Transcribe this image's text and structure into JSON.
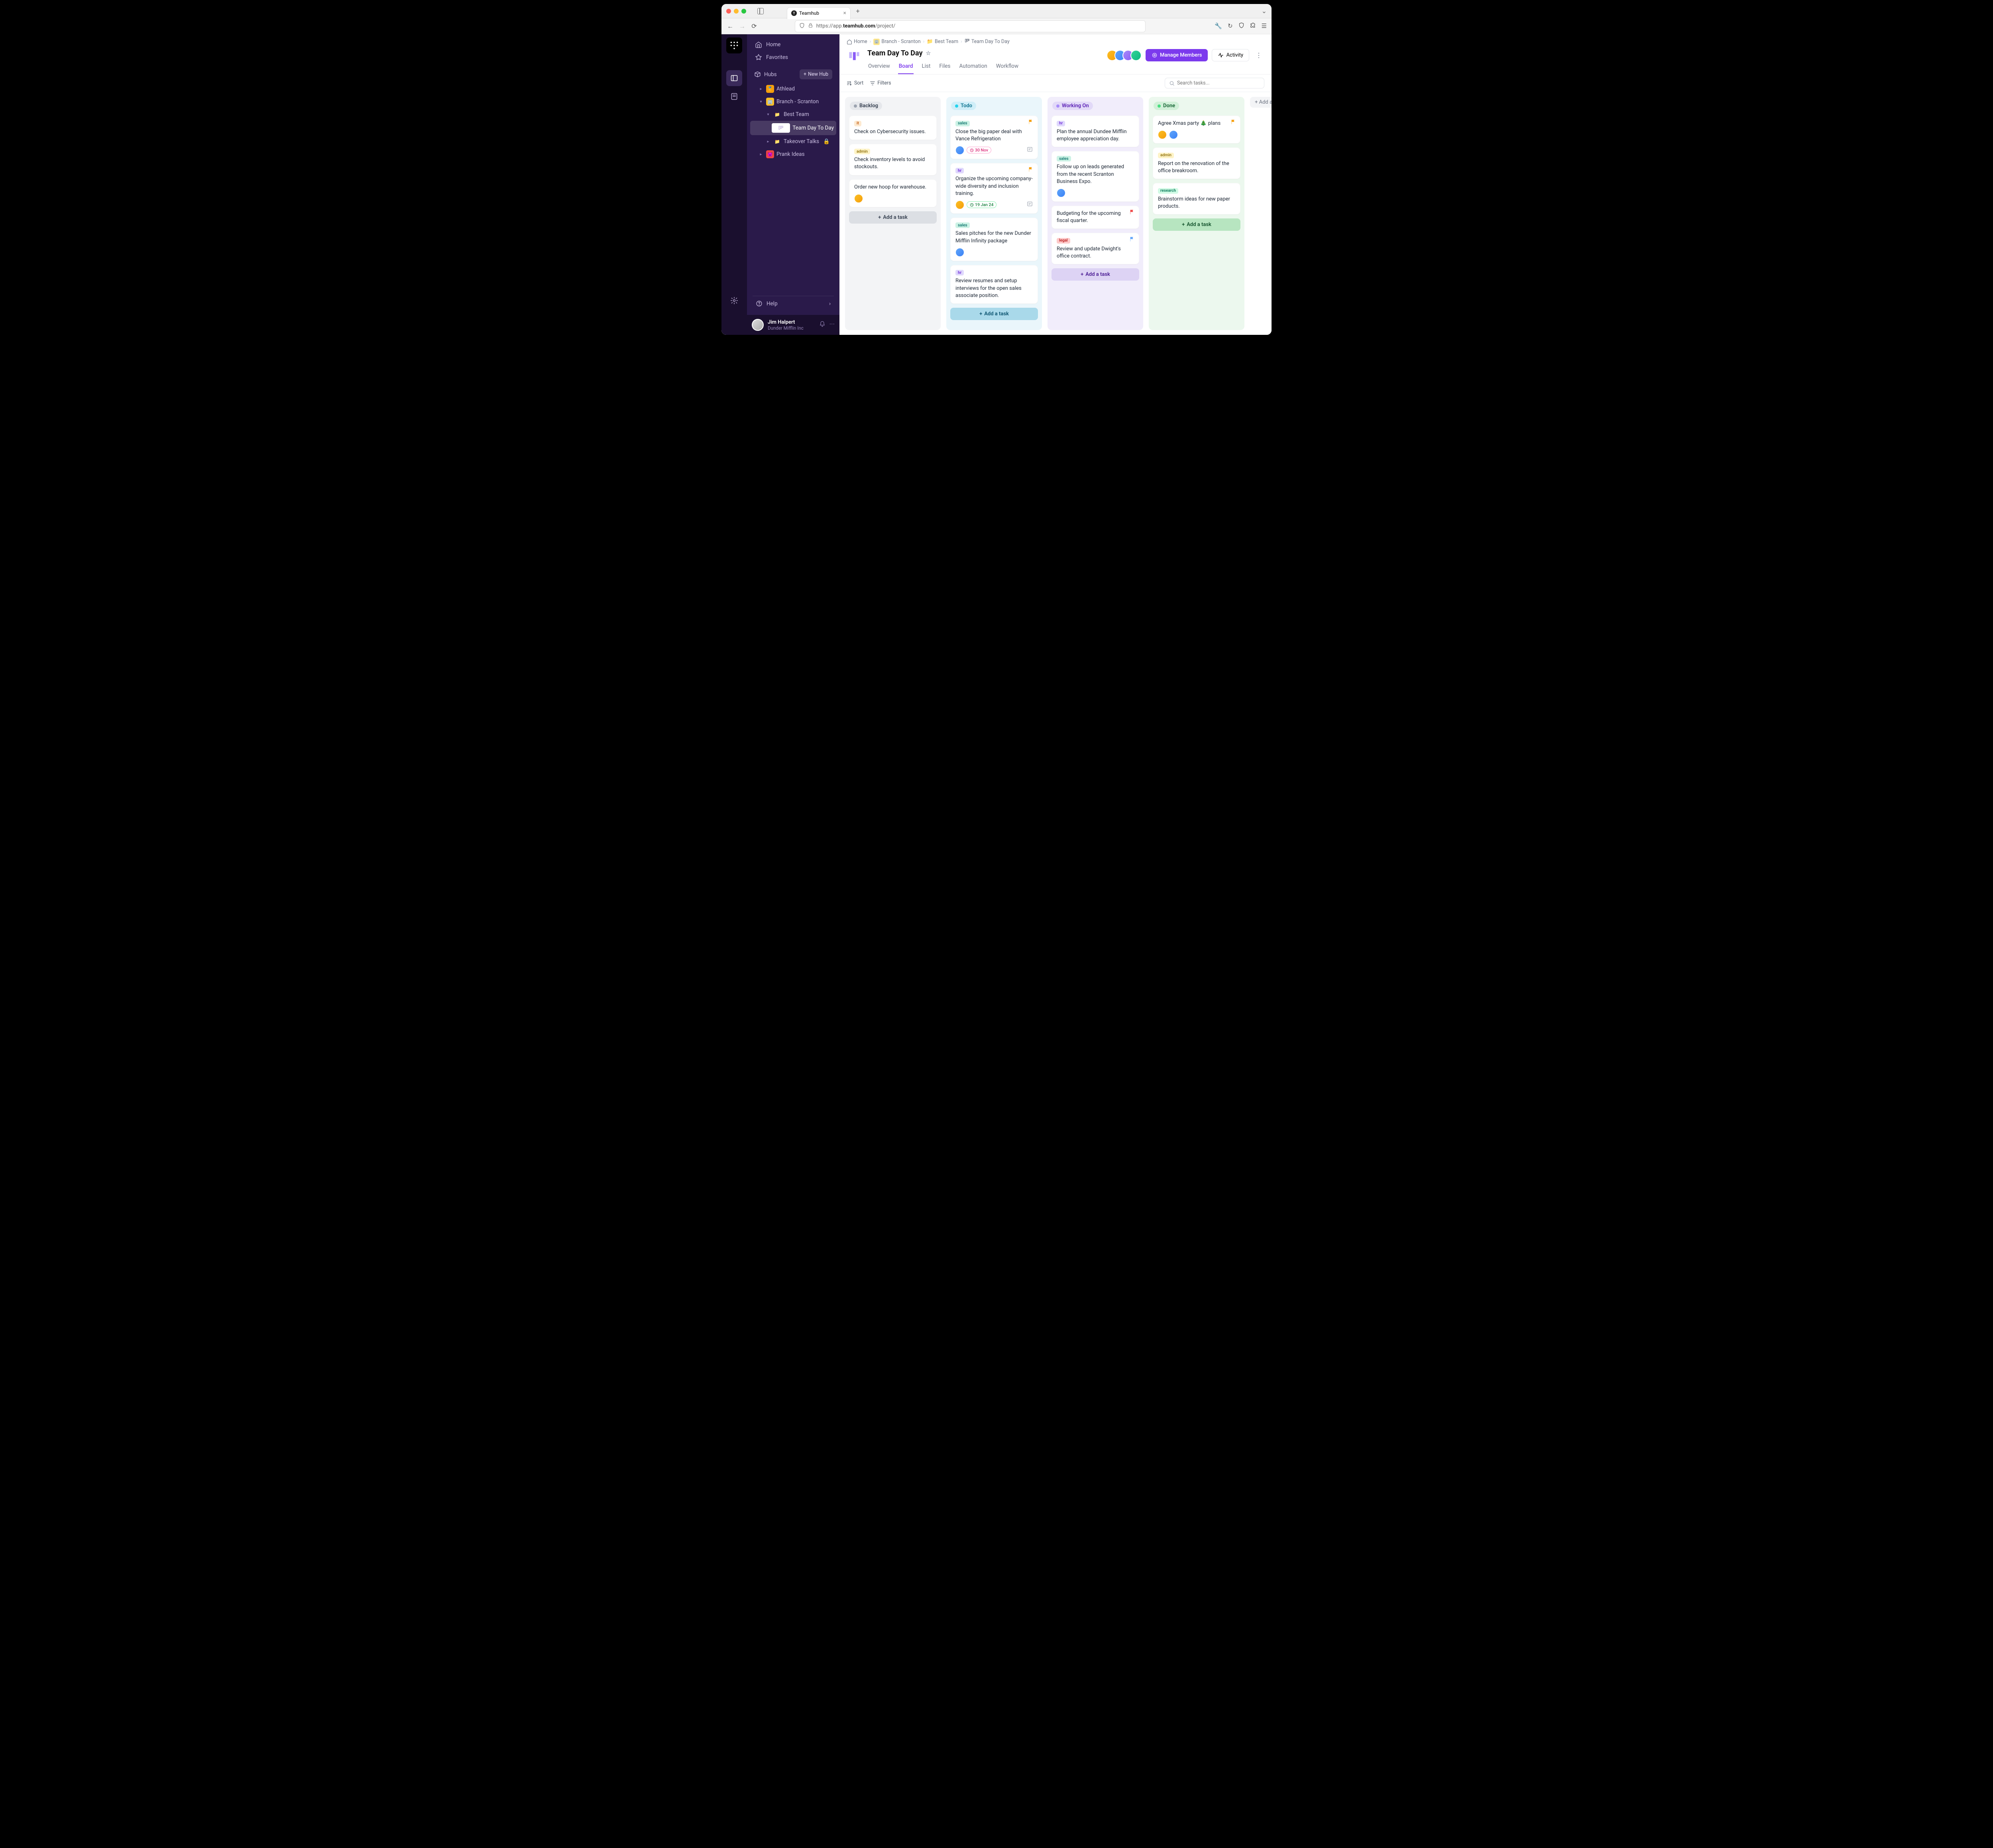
{
  "browser": {
    "tab_title": "Teamhub",
    "url_display": "https://app.teamhub.com/project/",
    "url_host": "teamhub.com",
    "url_prefix": "https://app.",
    "url_path": "/project/"
  },
  "sidenav": {
    "home": "Home",
    "favorites": "Favorites",
    "hubs": "Hubs",
    "new_hub": "New Hub",
    "help": "Help",
    "items": [
      {
        "label": "Athlead"
      },
      {
        "label": "Branch - Scranton"
      },
      {
        "label": "Best Team"
      },
      {
        "label": "Team Day To Day"
      },
      {
        "label": "Takeover Talks"
      },
      {
        "label": "Prank Ideas"
      }
    ]
  },
  "user": {
    "name": "Jim Halpert",
    "org": "Dunder Mifflin Inc"
  },
  "breadcrumb": {
    "home": "Home",
    "items": [
      {
        "label": "Branch - Scranton"
      },
      {
        "label": "Best Team"
      },
      {
        "label": "Team Day To Day"
      }
    ]
  },
  "page": {
    "title": "Team Day To Day",
    "tabs": [
      "Overview",
      "Board",
      "List",
      "Files",
      "Automation",
      "Workflow"
    ],
    "manage_members": "Manage Members",
    "activity": "Activity",
    "sort": "Sort",
    "filters": "Filters",
    "search_placeholder": "Search tasks...",
    "add_task": "Add a task",
    "add_new_column": "Add a new"
  },
  "columns": [
    {
      "key": "backlog",
      "title": "Backlog",
      "cards": [
        {
          "tag": "it",
          "title": "Check on Cybersecurity issues."
        },
        {
          "tag": "admin",
          "title": "Check inventory levels to avoid stockouts."
        },
        {
          "title": "Order new hoop for warehouse.",
          "avatars": [
            "c1"
          ]
        }
      ]
    },
    {
      "key": "todo",
      "title": "Todo",
      "cards": [
        {
          "tag": "sales",
          "flag": "#f59e0b",
          "title": "Close the big paper deal with Vance Refrigeration",
          "avatars": [
            "c2"
          ],
          "date": "30 Nov",
          "date_style": "pink",
          "subtask": true
        },
        {
          "tag": "hr",
          "flag": "#f59e0b",
          "title": "Organize the upcoming company-wide diversity and inclusion training.",
          "avatars": [
            "c1"
          ],
          "date": "19 Jan 24",
          "date_style": "green",
          "subtask": true
        },
        {
          "tag": "sales",
          "title": "Sales pitches for the new Dunder Mifflin Infinity package",
          "avatars": [
            "c2"
          ]
        },
        {
          "tag": "hr",
          "title": "Review resumes and setup interviews for the open sales associate position."
        }
      ]
    },
    {
      "key": "working",
      "title": "Working On",
      "cards": [
        {
          "tag": "hr",
          "title": "Plan the annual Dundee Mifflin employee appreciation day."
        },
        {
          "tag": "sales",
          "title": "Follow up on leads generated from the recent Scranton Business Expo.",
          "avatars": [
            "c2"
          ]
        },
        {
          "flag": "#ef4444",
          "title": "Budgeting for the upcoming fiscal quarter."
        },
        {
          "tag": "legal",
          "flag": "#60a5fa",
          "title": "Review and update Dwight's office contract."
        }
      ]
    },
    {
      "key": "done",
      "title": "Done",
      "cards": [
        {
          "flag": "#f59e0b",
          "title": "Agree Xmas party 🎄 plans",
          "avatars": [
            "c1",
            "c2"
          ]
        },
        {
          "tag": "admin",
          "title": "Report on the renovation of the office breakroom."
        },
        {
          "tag": "research",
          "title": "Brainstorm ideas for new paper products."
        }
      ]
    }
  ]
}
